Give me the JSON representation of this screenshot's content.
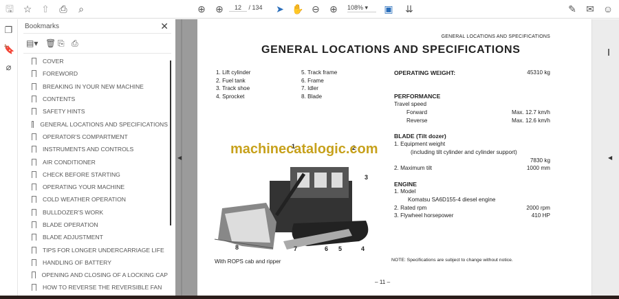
{
  "toolbar": {
    "page_current": "12",
    "page_total": "/ 134",
    "zoom": "108%"
  },
  "bookmarks": {
    "title": "Bookmarks",
    "items": [
      "COVER",
      "FOREWORD",
      "BREAKING IN YOUR NEW MACHINE",
      "CONTENTS",
      "SAFETY HINTS",
      "GENERAL LOCATIONS AND SPECIFICATIONS",
      "OPERATOR'S COMPARTMENT",
      "INSTRUMENTS AND CONTROLS",
      "AIR CONDITIONER",
      "CHECK BEFORE STARTING",
      "OPERATING YOUR MACHINE",
      "COLD WEATHER OPERATION",
      "BULLDOZER'S WORK",
      "BLADE OPERATION",
      "BLADE ADJUSTMENT",
      "TIPS FOR LONGER UNDERCARRIAGE LIFE",
      "HANDLING OF BATTERY",
      "OPENING AND CLOSING OF A LOCKING CAP",
      "HOW TO REVERSE THE REVERSIBLE FAN"
    ]
  },
  "page": {
    "running_header": "GENERAL LOCATIONS AND SPECIFICATIONS",
    "title": "GENERAL LOCATIONS AND SPECIFICATIONS",
    "parts_left": [
      "1.  Lift cylinder",
      "2.  Fuel tank",
      "3.  Track shoe",
      "4.  Sprocket"
    ],
    "parts_right": [
      "5.  Track frame",
      "6.  Frame",
      "7.  Idler",
      "8.  Blade"
    ],
    "operating_weight_label": "OPERATING WEIGHT:",
    "operating_weight": "45310 kg",
    "performance": "PERFORMANCE",
    "travel_speed": "Travel speed",
    "forward": "Forward",
    "forward_val": "Max. 12.7 km/h",
    "reverse": "Reverse",
    "reverse_val": "Max. 12.6 km/h",
    "blade": "BLADE (Tilt dozer)",
    "equip_weight": "1.  Equipment weight",
    "equip_note": "(including tilt cylinder and cylinder support)",
    "equip_val": "7830 kg",
    "max_tilt": "2.  Maximum tilt",
    "max_tilt_val": "1000 mm",
    "engine": "ENGINE",
    "model": "1.  Model",
    "model_val": "Komatsu SA6D155-4 diesel engine",
    "rpm": "2.  Rated rpm",
    "rpm_val": "2000 rpm",
    "hp": "3.  Flywheel horsepower",
    "hp_val": "410 HP",
    "watermark": "machinecatalogic.com",
    "callouts": [
      "1",
      "2",
      "3",
      "4",
      "5",
      "6",
      "7",
      "8"
    ],
    "caption": "With ROPS cab and ripper",
    "note": "NOTE:  Specifications are subject to change without notice.",
    "page_number": "– 11 –"
  },
  "colors": {
    "watermark": "#c7a11c",
    "accent": "#2a6ebb"
  }
}
